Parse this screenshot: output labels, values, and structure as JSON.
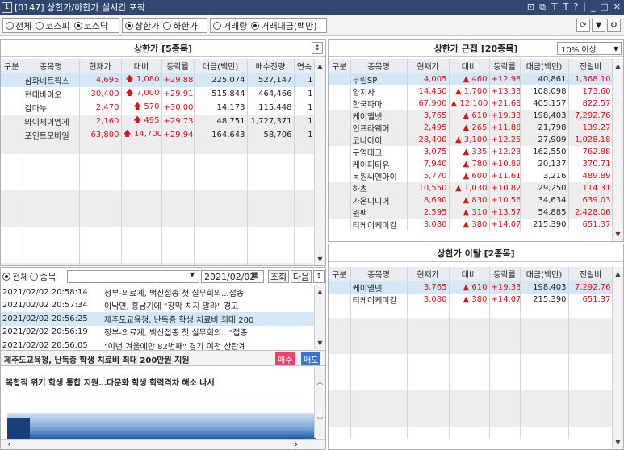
{
  "window": {
    "number": "1",
    "title": "[0147] 상한가/하한가 실시간 포착"
  },
  "filters": {
    "market": [
      "전체",
      "코스피",
      "코스닥"
    ],
    "market_selected": 2,
    "limit": [
      "상한가",
      "하한가"
    ],
    "limit_selected": 0,
    "sort": [
      "거래량",
      "거래대금(백만)"
    ],
    "sort_selected": 1
  },
  "upper": {
    "title": "상한가 [5종목]",
    "columns": [
      "구분",
      "종목명",
      "현재가",
      "대비",
      "등락률",
      "대금(백만)",
      "매수잔량",
      "연속"
    ],
    "rows": [
      {
        "name": "삼화네트웍스",
        "price": "4,695",
        "diff": "1,080",
        "rate": "+29.88",
        "amount": "225,074",
        "bid": "527,147",
        "streak": "1"
      },
      {
        "name": "현대바이오",
        "price": "30,400",
        "diff": "7,000",
        "rate": "+29.91",
        "amount": "515,844",
        "bid": "464,466",
        "streak": "1"
      },
      {
        "name": "감마누",
        "price": "2,470",
        "diff": "570",
        "rate": "+30.00",
        "amount": "14,173",
        "bid": "115,448",
        "streak": "1"
      },
      {
        "name": "와이제이엠게",
        "price": "2,160",
        "diff": "495",
        "rate": "+29.73",
        "amount": "48,751",
        "bid": "1,727,371",
        "streak": "1"
      },
      {
        "name": "포인트모바일",
        "price": "63,800",
        "diff": "14,700",
        "rate": "+29.94",
        "amount": "164,643",
        "bid": "58,706",
        "streak": "1"
      }
    ]
  },
  "near": {
    "title": "상한가 근접 [20종목]",
    "threshold": "10% 이상",
    "columns": [
      "구분",
      "종목명",
      "현재가",
      "대비",
      "등락률",
      "대금(백만)",
      "전일비"
    ],
    "rows": [
      {
        "name": "무림SP",
        "price": "4,005",
        "diff": "460",
        "rate": "+12.98",
        "amount": "40,861",
        "prev": "1,368.10"
      },
      {
        "name": "양지사",
        "price": "14,450",
        "diff": "1,700",
        "rate": "+13.33",
        "amount": "108,098",
        "prev": "173.60"
      },
      {
        "name": "한국파마",
        "price": "67,900",
        "diff": "12,100",
        "rate": "+21.68",
        "amount": "405,157",
        "prev": "822.57"
      },
      {
        "name": "케이엘넷",
        "price": "3,765",
        "diff": "610",
        "rate": "+19.33",
        "amount": "198,403",
        "prev": "7,292.76"
      },
      {
        "name": "인프라웨어",
        "price": "2,495",
        "diff": "265",
        "rate": "+11.88",
        "amount": "21,798",
        "prev": "139.27"
      },
      {
        "name": "코나아이",
        "price": "28,400",
        "diff": "3,100",
        "rate": "+12.25",
        "amount": "27,909",
        "prev": "1,028.18"
      },
      {
        "name": "구영테크",
        "price": "3,075",
        "diff": "335",
        "rate": "+12.23",
        "amount": "162,550",
        "prev": "762.88"
      },
      {
        "name": "케이피티유",
        "price": "7,940",
        "diff": "780",
        "rate": "+10.89",
        "amount": "20,137",
        "prev": "370.71"
      },
      {
        "name": "녹원씨엔아이",
        "price": "5,770",
        "diff": "600",
        "rate": "+11.61",
        "amount": "3,216",
        "prev": "489.89"
      },
      {
        "name": "하츠",
        "price": "10,550",
        "diff": "1,030",
        "rate": "+10.82",
        "amount": "29,250",
        "prev": "114.31"
      },
      {
        "name": "가온미디어",
        "price": "8,690",
        "diff": "830",
        "rate": "+10.56",
        "amount": "34,634",
        "prev": "639.03"
      },
      {
        "name": "윈팩",
        "price": "2,595",
        "diff": "310",
        "rate": "+13.57",
        "amount": "54,885",
        "prev": "2,428.06"
      },
      {
        "name": "티케이케미칼",
        "price": "3,080",
        "diff": "380",
        "rate": "+14.07",
        "amount": "215,390",
        "prev": "651.37"
      }
    ]
  },
  "depart": {
    "title": "상한가 이탈 [2종목]",
    "columns": [
      "구분",
      "종목명",
      "현재가",
      "대비",
      "등락률",
      "대금(백만)",
      "전일비"
    ],
    "rows": [
      {
        "name": "케이엘넷",
        "price": "3,765",
        "diff": "610",
        "rate": "+19.33",
        "amount": "198,403",
        "prev": "7,292.76"
      },
      {
        "name": "티케이케미칼",
        "price": "3,080",
        "diff": "380",
        "rate": "+14.07",
        "amount": "215,390",
        "prev": "651.37"
      }
    ]
  },
  "news": {
    "scope": [
      "전체",
      "종목"
    ],
    "scope_selected": 0,
    "date": "2021/02/02",
    "search_label": "조회",
    "next_label": "다음",
    "items": [
      {
        "time": "2021/02/02  20:58:14",
        "text": "정부-의료계, 백신접종 첫 실무회의...접종"
      },
      {
        "time": "2021/02/02  20:57:34",
        "text": "이낙연, 홍남기에 \"장막 치지 말라\" 경고"
      },
      {
        "time": "2021/02/02  20:56:25",
        "text": "제주도교육청, 난독증 학생 치료비 최대 200"
      },
      {
        "time": "2021/02/02  20:56:19",
        "text": "정부-의료계, 백신접종 첫 실무회의...\"접종"
      },
      {
        "time": "2021/02/02  20:56:05",
        "text": "\"이번 겨울에만 82번째\" 경기 이천 산란계"
      }
    ],
    "selected": 2,
    "headline": "제주도교육청, 난독증 학생 치료비 최대 200만원 지원",
    "buy_label": "매수",
    "sell_label": "매도",
    "body": "복합적 위기 학생 통합 지원…다문화 학생 학력격차 해소 나서"
  },
  "colors": {
    "up": "#d5141b",
    "title_bar": "#32476f",
    "selected_row": "#d4e7f7"
  }
}
